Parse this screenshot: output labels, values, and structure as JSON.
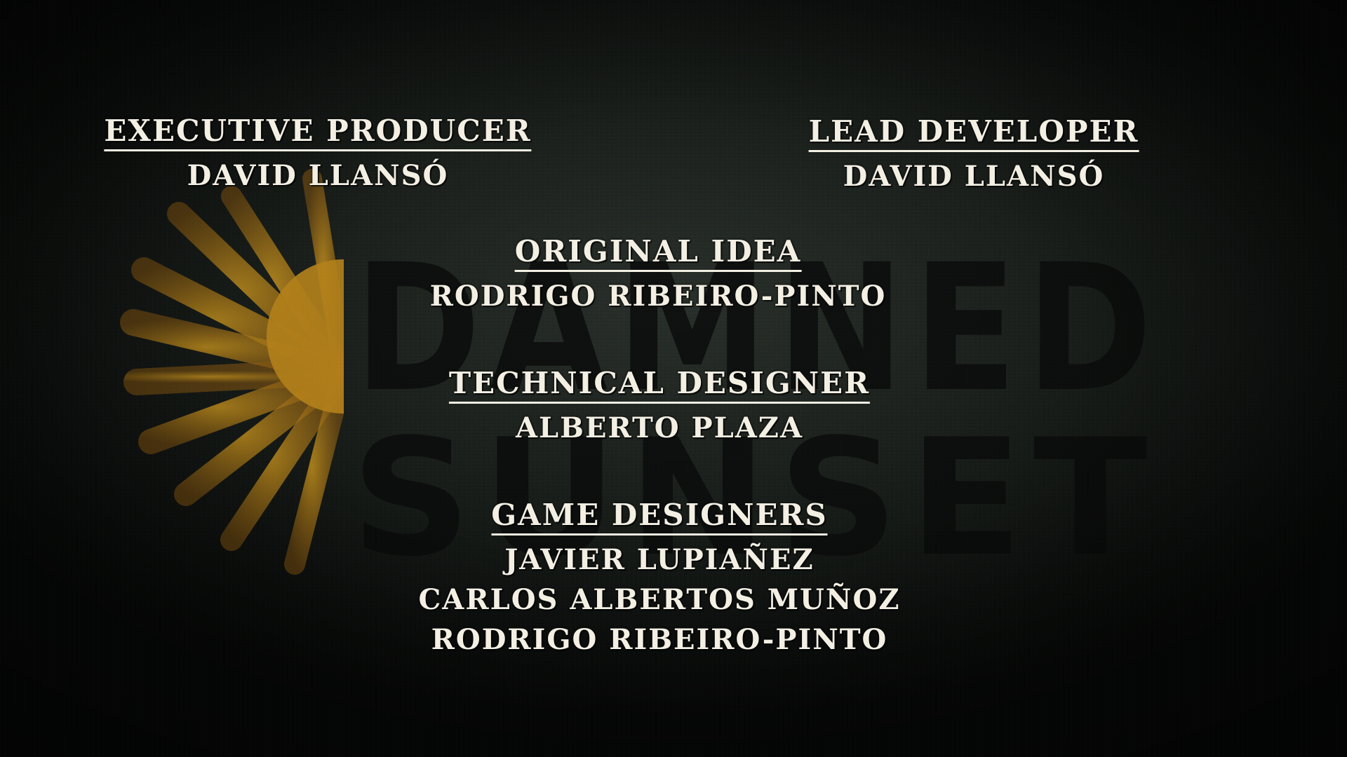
{
  "background": {
    "logo_word_1": "DAMNED",
    "logo_word_2": "SUNSET",
    "sun_color": "#e8a21c",
    "logo_icon": "sun-icon"
  },
  "credits": {
    "executive_producer": {
      "role": "Executive Producer",
      "names": [
        "David Llansó"
      ]
    },
    "lead_developer": {
      "role": "Lead Developer",
      "names": [
        "David Llansó"
      ]
    },
    "original_idea": {
      "role": "Original Idea",
      "names": [
        "Rodrigo Ribeiro-Pinto"
      ]
    },
    "technical_designer": {
      "role": "Technical Designer",
      "names": [
        "Alberto Plaza"
      ]
    },
    "game_designers": {
      "role": "Game Designers",
      "names": [
        "Javier Lupiañez",
        "Carlos Albertos Muñoz",
        "Rodrigo Ribeiro-Pinto"
      ]
    }
  }
}
